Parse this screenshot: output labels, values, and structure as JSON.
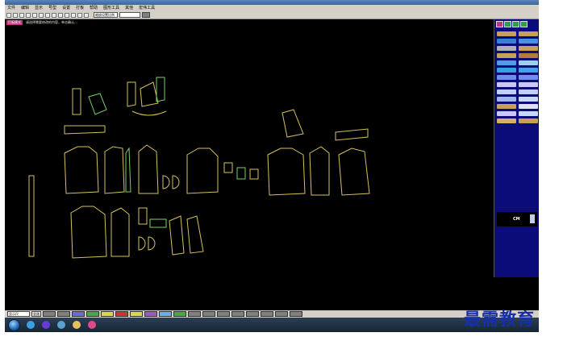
{
  "menu": {
    "items": [
      "文件",
      "编辑",
      "显示",
      "号型",
      "设置",
      "打板",
      "帮助",
      "图形工具",
      "其他",
      "宏伟工具"
    ]
  },
  "toolbar": {
    "size_select": "缩放设置比例",
    "icons": [
      "new-icon",
      "open-icon",
      "save-icon",
      "zoom-in-icon",
      "zoom-out-icon",
      "print-icon",
      "undo-icon",
      "redo-icon",
      "pointer-icon",
      "move-icon",
      "rotate-icon",
      "mirror-icon",
      "measure-icon"
    ]
  },
  "status": {
    "mode": "打板模式",
    "hint": "请选择需要修改的内容，单击确认..."
  },
  "right_panel": {
    "info_label": "CM",
    "tool_colors": [
      "#c7a05a",
      "#c7a05a",
      "#3a7fd6",
      "#4a8fe0",
      "#b0b0b0",
      "#c7a05a",
      "#c7a05a",
      "#b87a3a",
      "#4aa0e6",
      "#9fd0f0",
      "#3aa0e0",
      "#4aa0e6",
      "#6f8fe8",
      "#6f8fe8",
      "#c8c8f0",
      "#c8c8f0",
      "#c0d0f8",
      "#c0d0f8",
      "#9fb4f0",
      "#c8d8f8",
      "#c7a05a",
      "#e0e0f0",
      "#c8c8f0",
      "#c8d8f8",
      "#d4b06a",
      "#c7a05a"
    ]
  },
  "bottom": {
    "field_label": "显示尺",
    "button_label": "全选",
    "swatch_colors": [
      "#808080",
      "#808080",
      "#6a6ad8",
      "#44aa44",
      "#d8d84a",
      "#cc3333",
      "#d8d84a",
      "#9a58c8",
      "#6ab0e6",
      "#44aa44",
      "#808080",
      "#808080",
      "#808080",
      "#808080",
      "#808080",
      "#808080",
      "#808080",
      "#808080"
    ]
  },
  "taskbar": {
    "icons": [
      {
        "name": "browser-icon",
        "color": "#3aa0e6"
      },
      {
        "name": "media-icon",
        "color": "#6a3ad6"
      },
      {
        "name": "app-icon",
        "color": "#5aa0d0"
      },
      {
        "name": "folder-icon",
        "color": "#e6c060"
      },
      {
        "name": "cad-icon",
        "color": "#e04a8a"
      }
    ]
  },
  "watermark": "最需教育"
}
